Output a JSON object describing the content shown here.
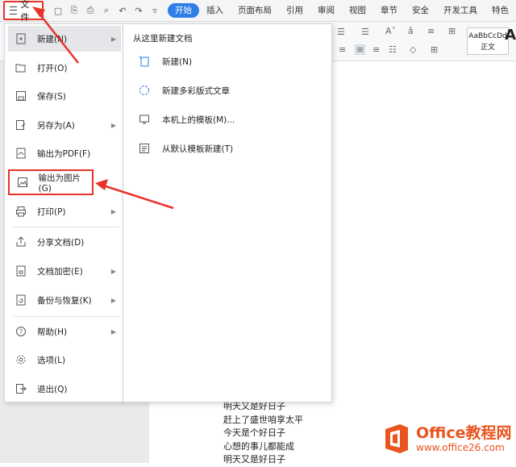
{
  "topbar": {
    "file_label": "文件",
    "tabs": [
      {
        "label": "开始",
        "active": true
      },
      {
        "label": "插入"
      },
      {
        "label": "页面布局"
      },
      {
        "label": "引用"
      },
      {
        "label": "审阅"
      },
      {
        "label": "视图"
      },
      {
        "label": "章节"
      },
      {
        "label": "安全"
      },
      {
        "label": "开发工具"
      },
      {
        "label": "特色"
      }
    ]
  },
  "ribbon": {
    "style_preview": "AaBbCcDd",
    "style_name": "正文",
    "style_big": "A"
  },
  "file_menu": {
    "items": [
      {
        "label": "新建(N)",
        "icon": "new-document-icon",
        "has_submenu": true
      },
      {
        "label": "打开(O)",
        "icon": "open-folder-icon"
      },
      {
        "label": "保存(S)",
        "icon": "save-icon"
      },
      {
        "label": "另存为(A)",
        "icon": "save-as-icon",
        "has_submenu": true
      },
      {
        "label": "输出为PDF(F)",
        "icon": "pdf-icon"
      },
      {
        "label": "输出为图片(G)",
        "icon": "image-export-icon"
      },
      {
        "label": "打印(P)",
        "icon": "printer-icon",
        "has_submenu": true
      },
      {
        "label": "分享文档(D)",
        "icon": "share-icon"
      },
      {
        "label": "文档加密(E)",
        "icon": "lock-icon",
        "has_submenu": true
      },
      {
        "label": "备份与恢复(K)",
        "icon": "backup-icon",
        "has_submenu": true
      },
      {
        "label": "帮助(H)",
        "icon": "help-icon",
        "has_submenu": true
      },
      {
        "label": "选项(L)",
        "icon": "gear-icon"
      },
      {
        "label": "退出(Q)",
        "icon": "exit-icon"
      }
    ]
  },
  "submenu": {
    "title": "从这里新建文档",
    "items": [
      {
        "label": "新建(N)",
        "icon": "new-document-icon"
      },
      {
        "label": "新建多彩版式文章",
        "icon": "colorful-article-icon"
      },
      {
        "label": "本机上的模板(M)...",
        "icon": "local-template-icon"
      },
      {
        "label": "从默认模板新建(T)",
        "icon": "default-template-icon"
      }
    ]
  },
  "document": {
    "lines": [
      "明天又是好日子",
      "赶上了盛世咱享太平",
      "今天是个好日子",
      "心想的事儿都能成",
      "明天又是好日子"
    ]
  },
  "watermark": {
    "title": "Office教程网",
    "url": "www.office26.com"
  },
  "colors": {
    "accent": "#2f7ee8",
    "annotation_red": "#e8322a",
    "watermark_orange": "#e8551f"
  }
}
